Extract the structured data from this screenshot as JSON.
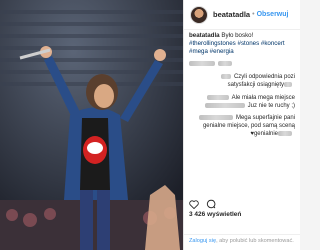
{
  "header": {
    "username": "beatatadla",
    "separator": "•",
    "follow_label": "Obserwuj"
  },
  "caption": {
    "username": "beatatadla",
    "text": "Było bosko!",
    "hashtags": "#therollingstones #stones #koncert #mega #energia"
  },
  "comments": [
    {
      "text": "Czyli odpowiednia pozi",
      "blur_before": true
    },
    {
      "text": "satysfakcji osiągnięty",
      "blur_after": true
    },
    {
      "text": "Ale miała mega miejsce",
      "blur_before": true
    },
    {
      "text": "Juz nie te ruchy ;)",
      "blur_before": true
    },
    {
      "text": "Mega superfajnie pani",
      "blur_before": true
    },
    {
      "text": "genialne miejsce, pod samą sceną",
      "blur_before": false
    },
    {
      "text": "♥genialnie",
      "blur_after": true
    }
  ],
  "actions": {
    "like_icon": "heart-icon",
    "comment_icon": "comment-icon"
  },
  "stats": {
    "views": "3 426 wyświetleń"
  },
  "date": "",
  "login": {
    "link": "Zaloguj się",
    "rest": ", aby polubić lub skomentować."
  },
  "colors": {
    "link_blue": "#3897f0",
    "hashtag_blue": "#003569",
    "photo_bg": "#2b2f38"
  }
}
